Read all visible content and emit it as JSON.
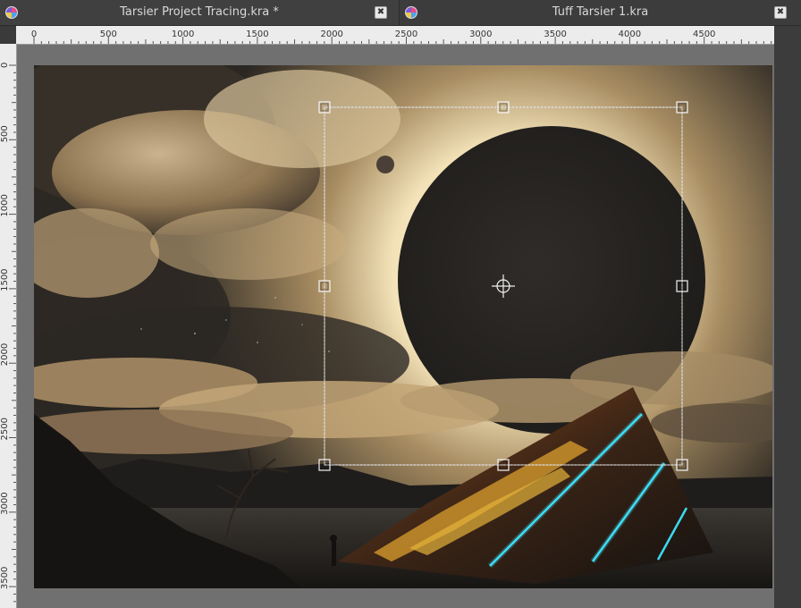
{
  "tabs": [
    {
      "title": "Tarsier Project Tracing.kra *",
      "icon": "krita-icon",
      "close_icon": "close-icon"
    },
    {
      "title": "Tuff Tarsier 1.kra",
      "icon": "krita-icon",
      "close_icon": "close-icon"
    }
  ],
  "ruler": {
    "horizontal_labels": [
      "0",
      "500",
      "1000",
      "1500",
      "2000",
      "2500",
      "3000",
      "3500",
      "4000",
      "4500"
    ],
    "vertical_labels": [
      "0",
      "500",
      "1000",
      "1500",
      "2000",
      "2500",
      "3000",
      "3500"
    ]
  },
  "canvas": {
    "image_description_name": "eclipse-scene-artwork",
    "transform_tool": "transform-handles"
  },
  "colors": {
    "tab_bg": "#404040",
    "ruler_bg": "#ececec",
    "workarea_bg": "#707070",
    "neon_accent": "#3fe6ff",
    "gold_accent": "#e5b43a"
  }
}
